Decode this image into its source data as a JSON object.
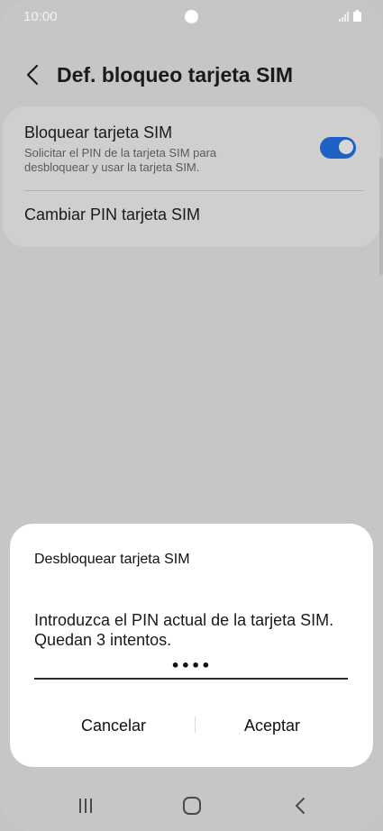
{
  "status_bar": {
    "time": "10:00"
  },
  "header": {
    "title": "Def. bloqueo tarjeta SIM",
    "back_icon": "chevron-left-icon"
  },
  "settings": {
    "lock_sim": {
      "title": "Bloquear tarjeta SIM",
      "subtitle": "Solicitar el PIN de la tarjeta SIM para desbloquear y usar la tarjeta SIM.",
      "enabled": true
    },
    "change_pin": {
      "title": "Cambiar PIN tarjeta SIM"
    }
  },
  "dialog": {
    "title": "Desbloquear tarjeta SIM",
    "message": "Introduzca el PIN actual de la tarjeta SIM. Quedan 3 intentos.",
    "pin_value": "••••",
    "cancel_label": "Cancelar",
    "accept_label": "Aceptar"
  },
  "colors": {
    "toggle_on": "#1f61c4",
    "dim_background": "#c6c6c6",
    "dialog_bg": "#ffffff"
  }
}
